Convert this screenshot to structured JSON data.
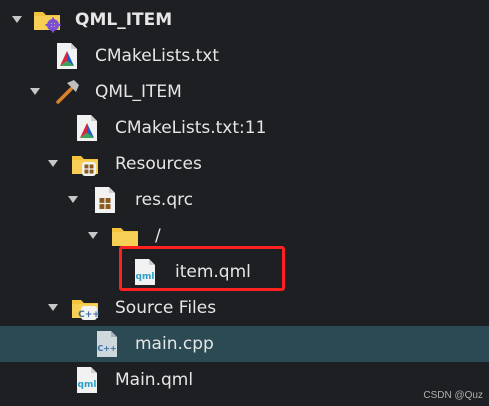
{
  "tree": {
    "root": {
      "label": "QML_ITEM"
    },
    "cmake_root": {
      "label": "CMakeLists.txt"
    },
    "project": {
      "label": "QML_ITEM"
    },
    "cmake_project": {
      "label": "CMakeLists.txt:11"
    },
    "resources": {
      "label": "Resources"
    },
    "res_qrc": {
      "label": "res.qrc"
    },
    "slash_folder": {
      "label": "/"
    },
    "item_qml": {
      "label": "item.qml"
    },
    "source_files": {
      "label": "Source Files"
    },
    "main_cpp": {
      "label": "main.cpp"
    },
    "main_qml": {
      "label": "Main.qml"
    }
  },
  "watermark": "CSDN @Quz",
  "colors": {
    "background": "#1e1f22",
    "selection": "#2b4a54",
    "highlight": "#ff2020",
    "folder": "#f3c23f",
    "qml_icon": "#2aa0c8"
  }
}
